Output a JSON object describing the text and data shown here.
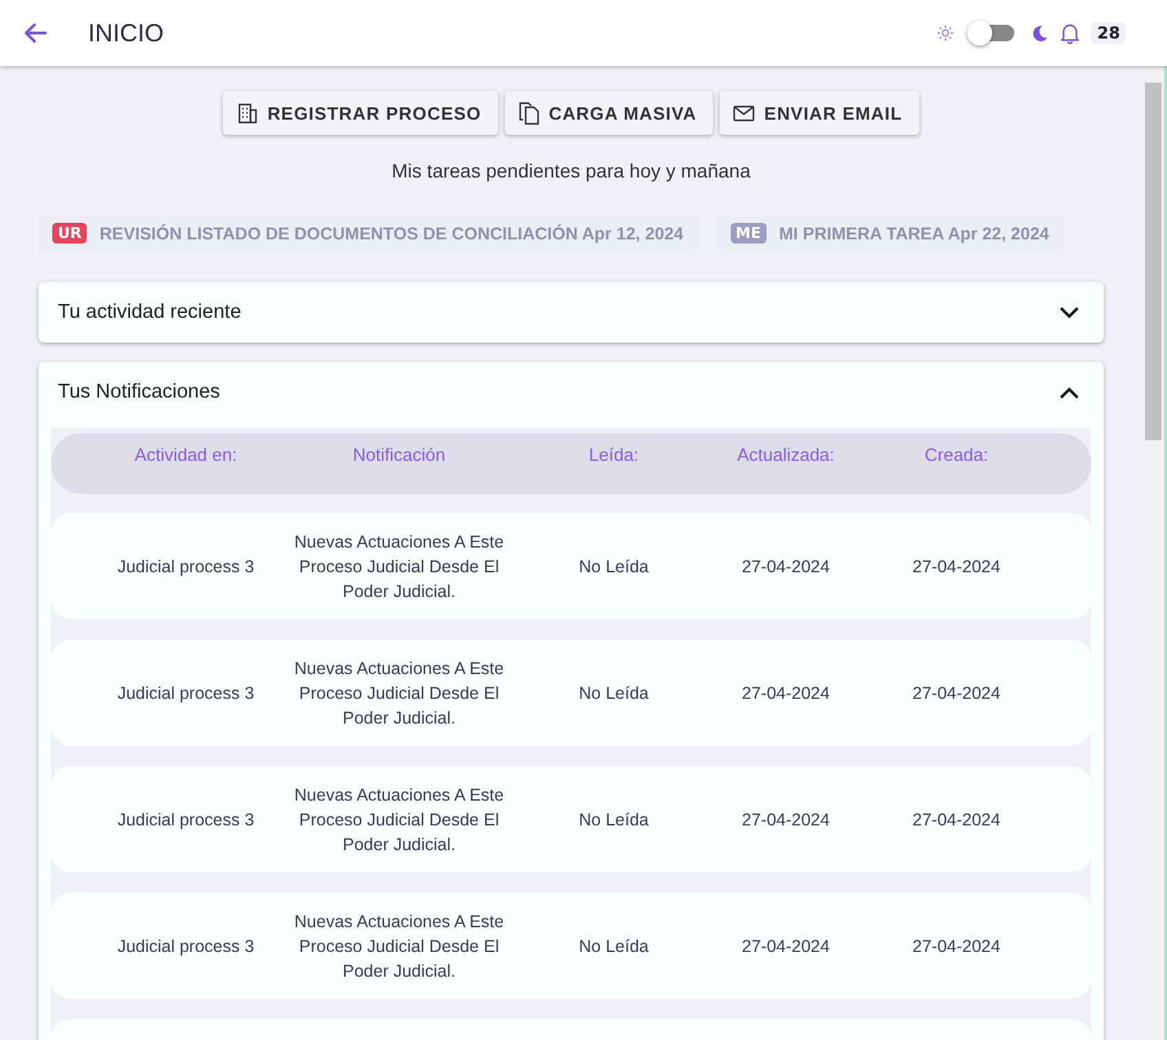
{
  "header": {
    "title": "INICIO",
    "dark_mode": false,
    "notification_count": "28"
  },
  "actions": [
    {
      "kind": "building",
      "label": "REGISTRAR PROCESO"
    },
    {
      "kind": "copy",
      "label": "CARGA MASIVA"
    },
    {
      "kind": "mail",
      "label": "ENVIAR EMAIL"
    }
  ],
  "tasks_title": "Mis tareas pendientes para hoy y mañana",
  "tasks": [
    {
      "badge": "UR",
      "color": "#e5445a",
      "text": "REVISIÓN LISTADO DE DOCUMENTOS DE CONCILIACIÓN Apr 12, 2024"
    },
    {
      "badge": "ME",
      "color": "#9c9dc2",
      "text": "MI PRIMERA TAREA Apr 22, 2024"
    }
  ],
  "panels": [
    {
      "title": "Tu actividad reciente",
      "expanded": false
    },
    {
      "title": "Tus Notificaciones",
      "expanded": true
    }
  ],
  "table": {
    "columns": [
      "Actividad en:",
      "Notificación",
      "Leída:",
      "Actualizada:",
      "Creada:"
    ],
    "rows": [
      [
        "Judicial process 3",
        "Nuevas Actuaciones A Este Proceso Judicial Desde El Poder Judicial.",
        "No Leída",
        "27-04-2024",
        "27-04-2024"
      ],
      [
        "Judicial process 3",
        "Nuevas Actuaciones A Este Proceso Judicial Desde El Poder Judicial.",
        "No Leída",
        "27-04-2024",
        "27-04-2024"
      ],
      [
        "Judicial process 3",
        "Nuevas Actuaciones A Este Proceso Judicial Desde El Poder Judicial.",
        "No Leída",
        "27-04-2024",
        "27-04-2024"
      ],
      [
        "Judicial process 3",
        "Nuevas Actuaciones A Este Proceso Judicial Desde El Poder Judicial.",
        "No Leída",
        "27-04-2024",
        "27-04-2024"
      ]
    ]
  }
}
